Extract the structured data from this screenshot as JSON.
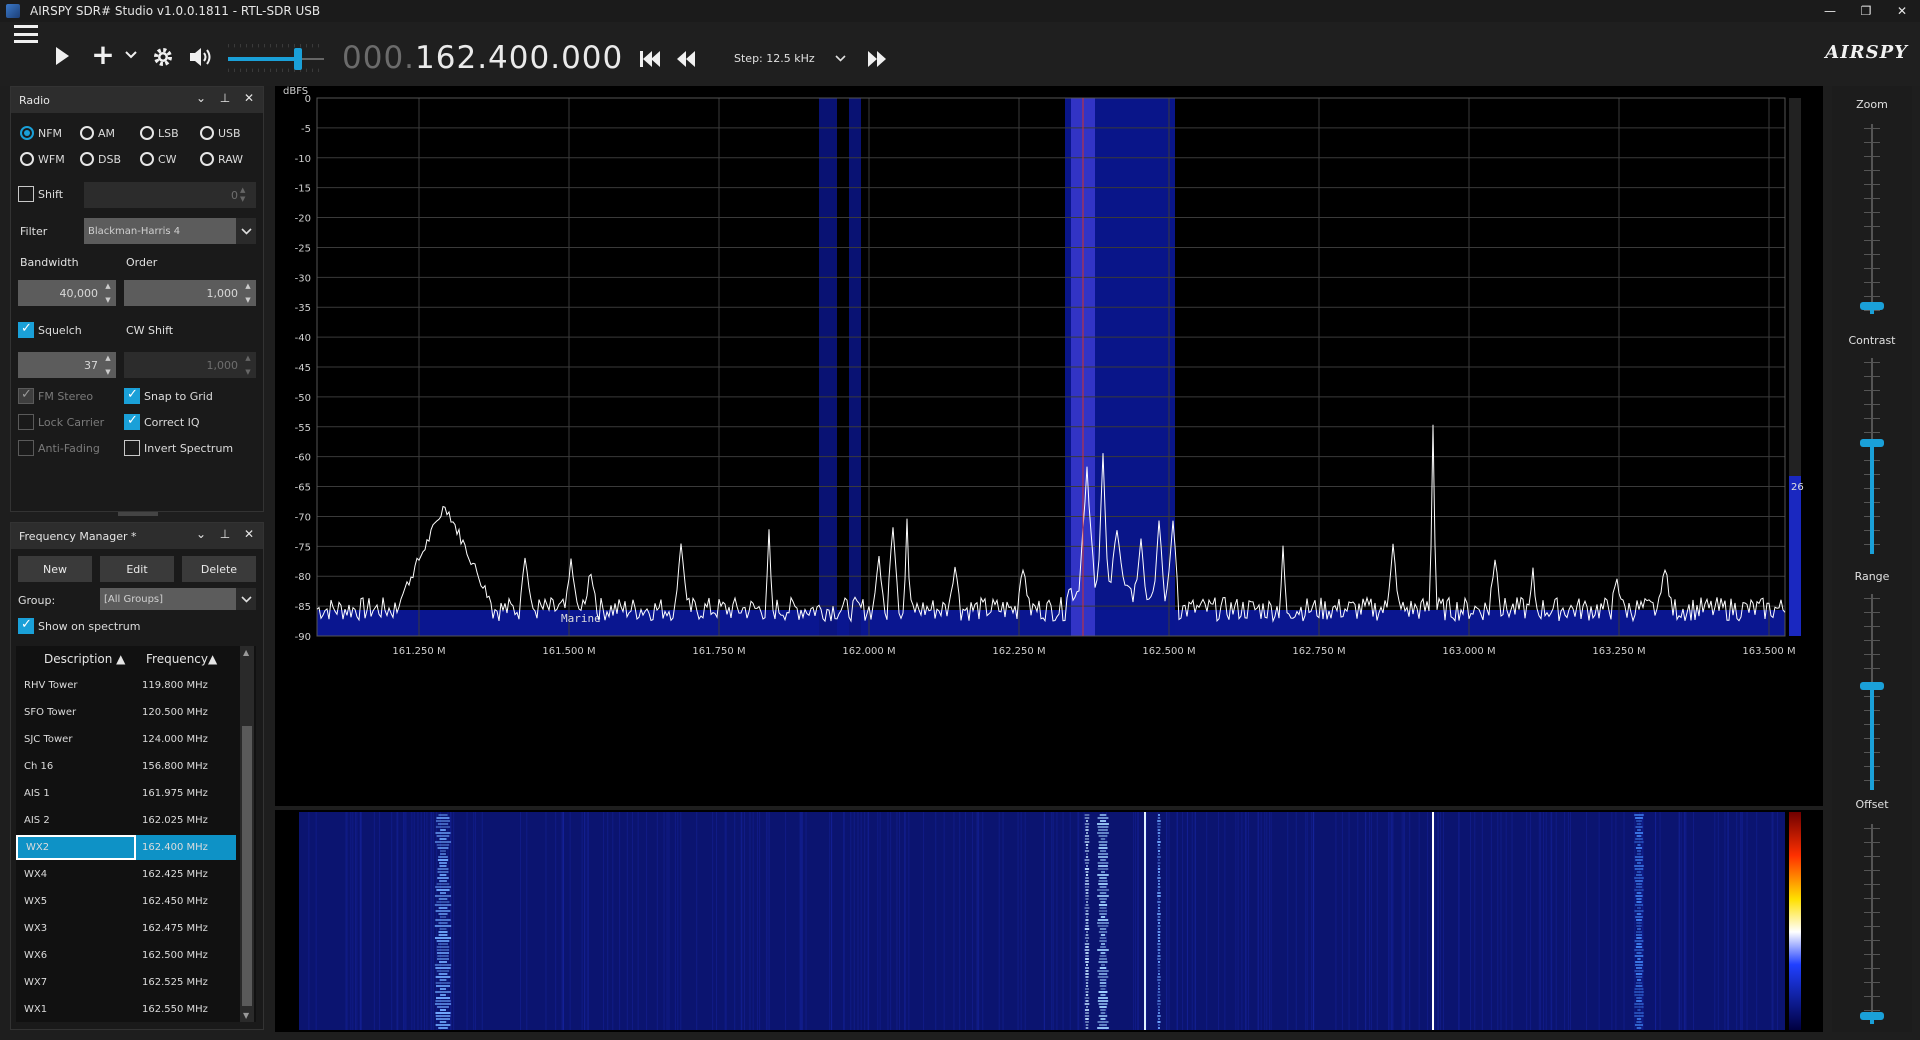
{
  "window": {
    "title": "AIRSPY SDR# Studio v1.0.0.1811 - RTL-SDR USB",
    "minimize": "—",
    "maximize": "❐",
    "close": "✕"
  },
  "toolbar": {
    "add_symbol": "+",
    "frequency_dim": "000.",
    "frequency_main": "162.400.000",
    "step_label": "Step: 12.5 kHz",
    "volume_level": 0.73,
    "logo": "AIRSPY"
  },
  "radio": {
    "title": "Radio",
    "modes": [
      {
        "label": "NFM",
        "selected": true
      },
      {
        "label": "AM",
        "selected": false
      },
      {
        "label": "LSB",
        "selected": false
      },
      {
        "label": "USB",
        "selected": false
      },
      {
        "label": "WFM",
        "selected": false
      },
      {
        "label": "DSB",
        "selected": false
      },
      {
        "label": "CW",
        "selected": false
      },
      {
        "label": "RAW",
        "selected": false
      }
    ],
    "shift_label": "Shift",
    "shift_value": "0",
    "filter_label": "Filter",
    "filter_value": "Blackman-Harris 4",
    "bandwidth_label": "Bandwidth",
    "bandwidth_value": "40,000",
    "order_label": "Order",
    "order_value": "1,000",
    "squelch_label": "Squelch",
    "squelch_value": "37",
    "cw_shift_label": "CW Shift",
    "cw_shift_value": "1,000",
    "fm_stereo_label": "FM Stereo",
    "snap_grid_label": "Snap to Grid",
    "lock_carrier_label": "Lock Carrier",
    "correct_iq_label": "Correct IQ",
    "anti_fading_label": "Anti-Fading",
    "invert_spectrum_label": "Invert Spectrum"
  },
  "freq_manager": {
    "title": "Frequency Manager *",
    "new_label": "New",
    "edit_label": "Edit",
    "delete_label": "Delete",
    "group_label": "Group:",
    "group_value": "[All Groups]",
    "show_on_spectrum_label": "Show on spectrum",
    "col_description": "Description",
    "col_frequency": "Frequency",
    "rows": [
      {
        "desc": "RHV Tower",
        "freq": "119.800 MHz"
      },
      {
        "desc": "SFO Tower",
        "freq": "120.500 MHz"
      },
      {
        "desc": "SJC Tower",
        "freq": "124.000 MHz"
      },
      {
        "desc": "Ch 16",
        "freq": "156.800 MHz"
      },
      {
        "desc": "AIS 1",
        "freq": "161.975 MHz"
      },
      {
        "desc": "AIS 2",
        "freq": "162.025 MHz"
      },
      {
        "desc": "WX2",
        "freq": "162.400 MHz",
        "selected": true
      },
      {
        "desc": "WX4",
        "freq": "162.425 MHz"
      },
      {
        "desc": "WX5",
        "freq": "162.450 MHz"
      },
      {
        "desc": "WX3",
        "freq": "162.475 MHz"
      },
      {
        "desc": "WX6",
        "freq": "162.500 MHz"
      },
      {
        "desc": "WX7",
        "freq": "162.525 MHz"
      },
      {
        "desc": "WX1",
        "freq": "162.550 MHz"
      }
    ]
  },
  "spectrum": {
    "unit_label": "dBFS",
    "y_ticks": [
      "0",
      "-5",
      "-10",
      "-15",
      "-20",
      "-25",
      "-30",
      "-35",
      "-40",
      "-45",
      "-50",
      "-55",
      "-60",
      "-65",
      "-70",
      "-75",
      "-80",
      "-85",
      "-90"
    ],
    "x_ticks": [
      "161.250 M",
      "161.500 M",
      "161.750 M",
      "162.000 M",
      "162.250 M",
      "162.500 M",
      "162.750 M",
      "163.000 M",
      "163.250 M",
      "163.500 M"
    ],
    "band_label": "Marine",
    "level_readout": "26",
    "colors": {
      "band": "#0a1690",
      "filter": "#3a3ad0",
      "center": "#d03030",
      "trace": "#ffffff",
      "grid": "#3a3a3a"
    }
  },
  "sliders": {
    "zoom_label": "Zoom",
    "contrast_label": "Contrast",
    "range_label": "Range",
    "offset_label": "Offset",
    "zoom_level": 0.0,
    "contrast_level": 0.56,
    "range_level": 0.52,
    "offset_level": 0.0
  }
}
